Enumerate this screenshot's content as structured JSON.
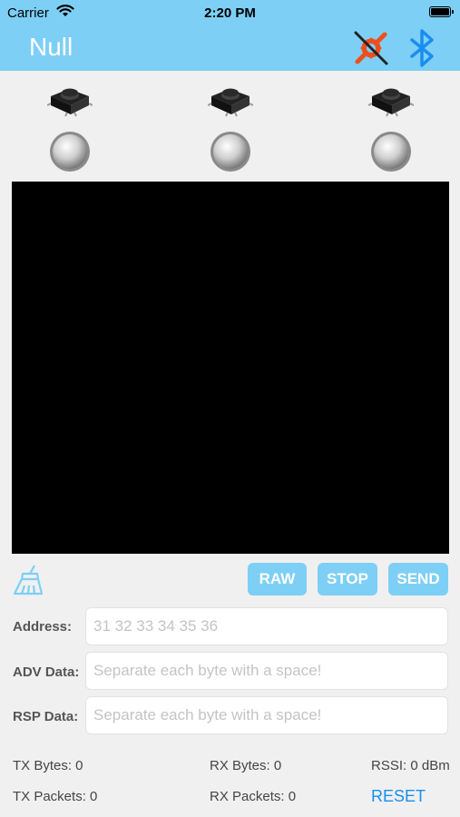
{
  "status_bar": {
    "carrier": "Carrier",
    "time": "2:20 PM"
  },
  "nav": {
    "title": "Null"
  },
  "switches": [
    {
      "id": "switch-1"
    },
    {
      "id": "switch-2"
    },
    {
      "id": "switch-3"
    }
  ],
  "leds": [
    {
      "id": "led-1"
    },
    {
      "id": "led-2"
    },
    {
      "id": "led-3"
    }
  ],
  "toolbar": {
    "raw": "RAW",
    "stop": "STOP",
    "send": "SEND"
  },
  "form": {
    "address_label": "Address:",
    "address_placeholder": "31 32 33 34 35 36",
    "adv_label": "ADV Data:",
    "adv_placeholder": "Separate each byte with a space!",
    "rsp_label": "RSP Data:",
    "rsp_placeholder": "Separate each byte with a space!"
  },
  "stats": {
    "tx_bytes": "TX Bytes: 0",
    "rx_bytes": "RX Bytes: 0",
    "rssi": "RSSI: 0 dBm",
    "tx_packets": "TX Packets: 0",
    "rx_packets": "RX Packets: 0",
    "reset": "RESET"
  },
  "colors": {
    "accent": "#7dcff5",
    "link": "#1a8ef0",
    "disconnected_icon": "#f04e1e",
    "bluetooth": "#1a8ef0"
  },
  "icons": {
    "connection": "link-disconnected-icon",
    "bluetooth": "bluetooth-icon",
    "clear": "broom-icon",
    "switch": "tactile-switch-icon",
    "led": "led-icon"
  }
}
